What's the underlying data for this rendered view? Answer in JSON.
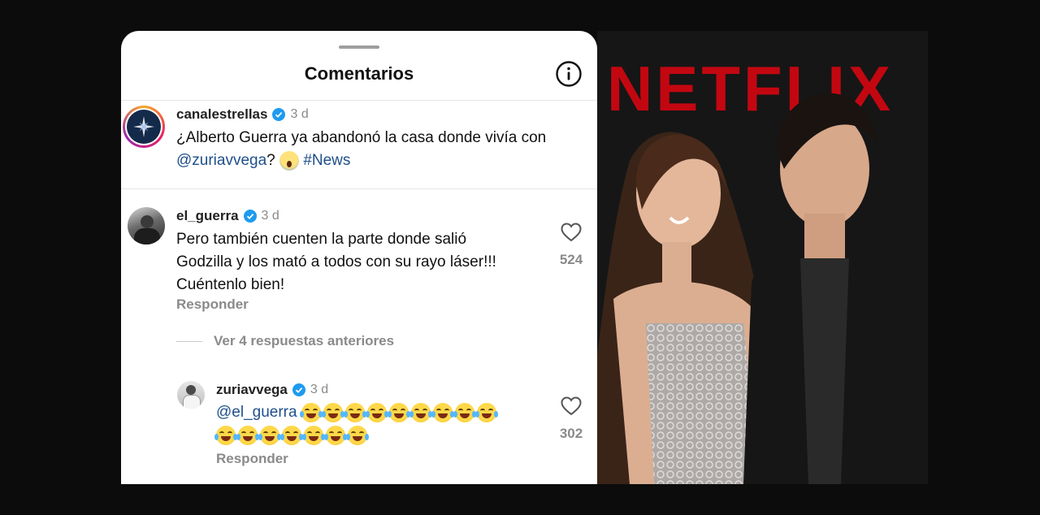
{
  "sheet": {
    "title": "Comentarios"
  },
  "post": {
    "username": "canalestrellas",
    "time": "3 d",
    "text_line1": "¿Alberto Guerra ya abandonó la casa donde vivía con",
    "mention": "@zuriavvega",
    "suffix": "?",
    "hashtag": "#News"
  },
  "comments": [
    {
      "username": "el_guerra",
      "time": "3 d",
      "lines": [
        "Pero también cuenten la parte donde salió",
        "Godzilla y los mató a todos con su rayo láser!!!",
        "Cuéntenlo bien!"
      ],
      "reply_label": "Responder",
      "likes": "524"
    },
    {
      "username": "zuriavvega",
      "time": "3 d",
      "mention": "@el_guerra",
      "emoji_name": "face-with-tears-of-joy",
      "emoji_count_line1": 9,
      "emoji_count_line2": 7,
      "reply_label": "Responder",
      "likes": "302"
    }
  ],
  "view_replies_label": "Ver 4 respuestas anteriores",
  "photo": {
    "backdrop_text": "NETFLIX",
    "colors": {
      "backdrop": "#1b1b1b",
      "brand": "#e50914"
    }
  }
}
